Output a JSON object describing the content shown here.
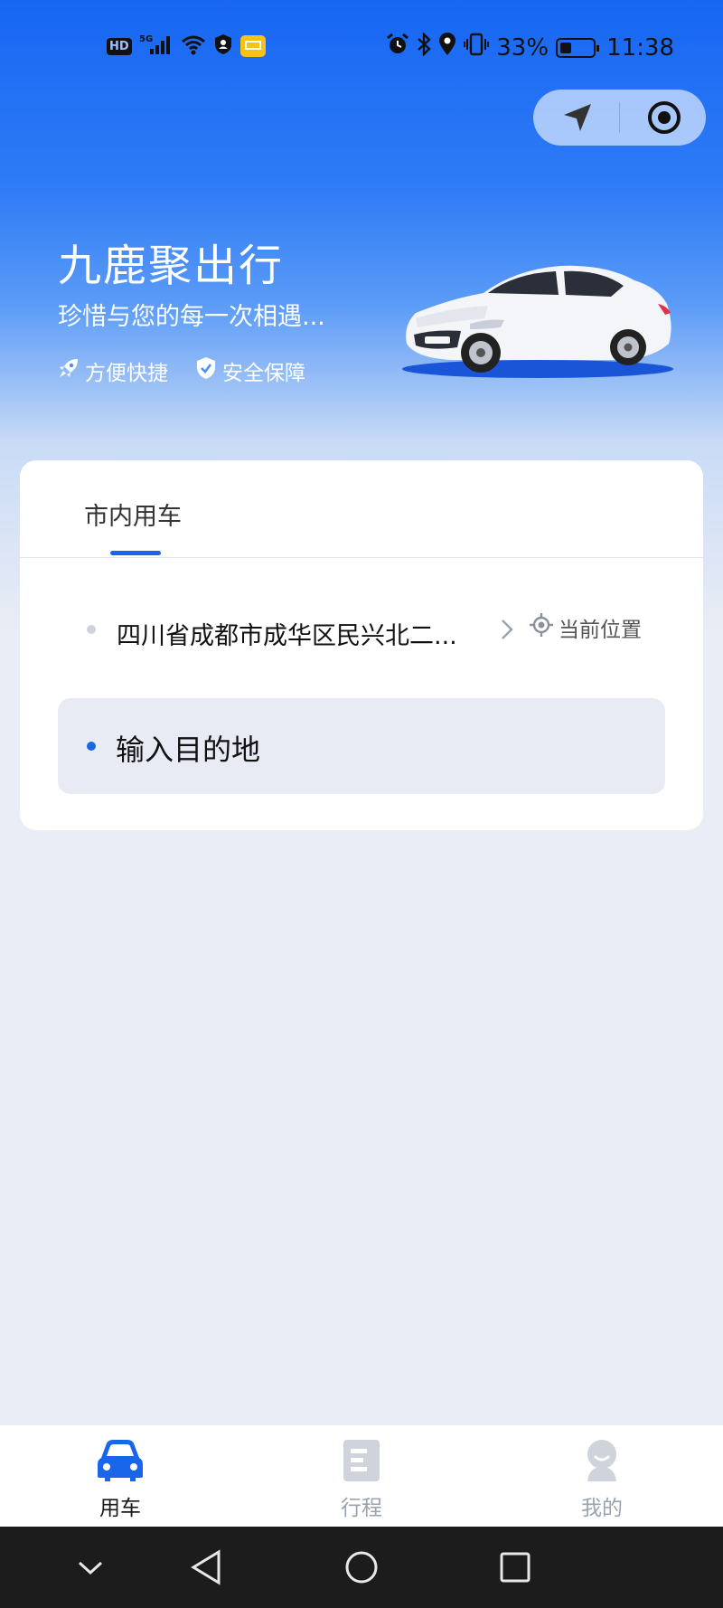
{
  "status_bar": {
    "left_icons": [
      "hd-icon",
      "5g-signal-icon",
      "wifi-icon",
      "vpn-icon",
      "mail-icon"
    ],
    "network_label": "HD",
    "network_gen": "5G",
    "battery_percent": "33%",
    "time": "11:38",
    "right_icons": [
      "alarm-icon",
      "bluetooth-icon",
      "location-icon",
      "vibrate-icon",
      "battery-icon"
    ]
  },
  "capsule": {
    "icons": [
      "navigation-arrow-icon",
      "target-icon"
    ]
  },
  "hero": {
    "title": "九鹿聚出行",
    "subtitle": "珍惜与您的每一次相遇...",
    "tags": [
      {
        "icon": "rocket-icon",
        "label": "方便快捷"
      },
      {
        "icon": "shield-check-icon",
        "label": "安全保障"
      }
    ]
  },
  "card": {
    "tab_label": "市内用车",
    "from_address": "四川省成都市成华区民兴北二...",
    "current_location_label": "当前位置",
    "destination_placeholder": "输入目的地"
  },
  "bottom_nav": {
    "items": [
      {
        "label": "用车",
        "icon": "car-icon",
        "active": true
      },
      {
        "label": "行程",
        "icon": "document-icon",
        "active": false
      },
      {
        "label": "我的",
        "icon": "profile-icon",
        "active": false
      }
    ]
  },
  "colors": {
    "accent": "#1a66e8",
    "header_gradient_top": "#1766f2",
    "page_bg": "#eaedf5",
    "inactive_nav": "#9aa3b2"
  }
}
